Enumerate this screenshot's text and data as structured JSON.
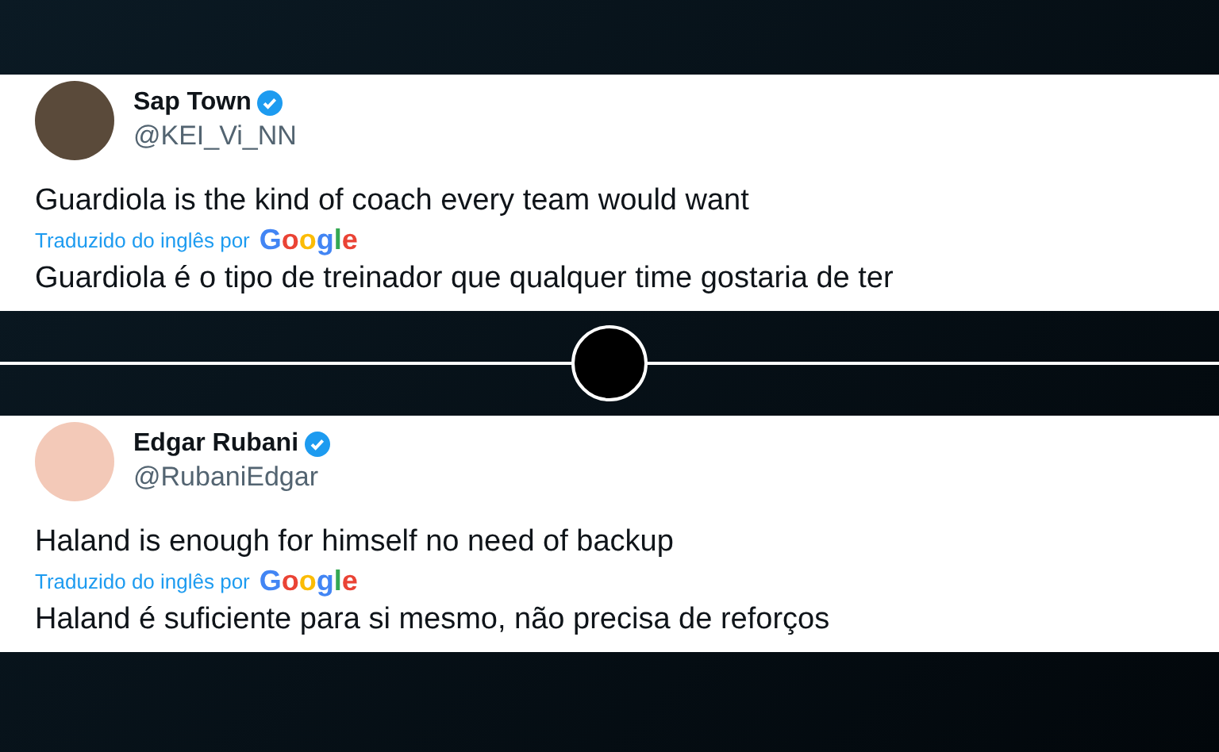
{
  "tweets": [
    {
      "name": "Sap Town",
      "handle": "@KEI_Vi_NN",
      "text": "Guardiola is the kind of coach every team would want",
      "translated_label": "Traduzido do inglês por",
      "translator": "Google",
      "translation": "Guardiola é o tipo de treinador que qualquer time gostaria de ter",
      "verified": true
    },
    {
      "name": "Edgar Rubani",
      "handle": "@RubaniEdgar",
      "text": "Haland is enough for himself no need of backup",
      "translated_label": "Traduzido do inglês por",
      "translator": "Google",
      "translation": "Haland é suficiente para si mesmo, não precisa de reforços",
      "verified": true
    }
  ]
}
